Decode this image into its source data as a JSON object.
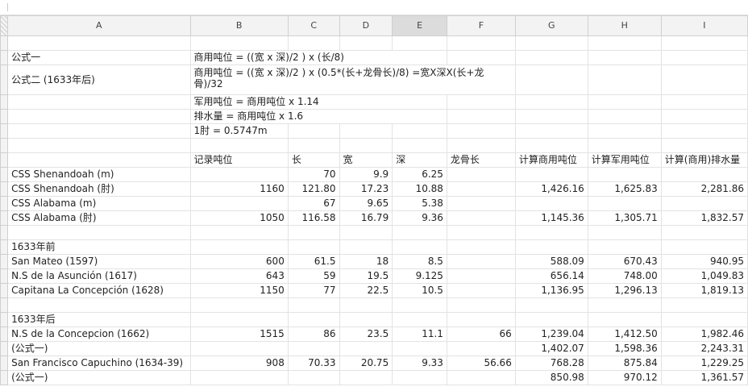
{
  "columns": [
    "A",
    "B",
    "C",
    "D",
    "E",
    "F",
    "G",
    "H",
    "I"
  ],
  "formulas": {
    "f1_label": "公式一",
    "f1_text": "商用吨位 = ((宽 x 深)/2 ) x (长/8)",
    "f2_label": "公式二 (1633年后)",
    "f2_text": "商用吨位 = ((宽 x 深)/2 ) x (0.5*(长+龙骨长)/8) =宽X深X(长+龙骨)/32",
    "military": "军用吨位 = 商用吨位 x 1.14",
    "displacement": "排水量 = 商用吨位 x 1.6",
    "unit": "1肘 = 0.5747m"
  },
  "header": {
    "recorded": "记录吨位",
    "length": "长",
    "width": "宽",
    "depth": "深",
    "keel": "龙骨长",
    "calc_comm": "计算商用吨位",
    "calc_mil": "计算军用吨位",
    "calc_disp": "计算(商用)排水量"
  },
  "rows": {
    "r1": {
      "name": "CSS Shenandoah (m)",
      "c": "70",
      "d": "9.9",
      "e": "6.25"
    },
    "r2": {
      "name": "CSS Shenandoah (肘)",
      "b": "1160",
      "c": "121.80",
      "d": "17.23",
      "e": "10.88",
      "g": "1,426.16",
      "h": "1,625.83",
      "i": "2,281.86"
    },
    "r3": {
      "name": "CSS Alabama (m)",
      "c": "67",
      "d": "9.65",
      "e": "5.38"
    },
    "r4": {
      "name": "CSS Alabama (肘)",
      "b": "1050",
      "c": "116.58",
      "d": "16.79",
      "e": "9.36",
      "g": "1,145.36",
      "h": "1,305.71",
      "i": "1,832.57"
    },
    "sec1": "1633年前",
    "r5": {
      "name": "San Mateo (1597)",
      "b": "600",
      "c": "61.5",
      "d": "18",
      "e": "8.5",
      "g": "588.09",
      "h": "670.43",
      "i": "940.95"
    },
    "r6": {
      "name": "N.S de la Asunción (1617)",
      "b": "643",
      "c": "59",
      "d": "19.5",
      "e": "9.125",
      "g": "656.14",
      "h": "748.00",
      "i": "1,049.83"
    },
    "r7": {
      "name": "Capitana La Concepción (1628)",
      "b": "1150",
      "c": "77",
      "d": "22.5",
      "e": "10.5",
      "g": "1,136.95",
      "h": "1,296.13",
      "i": "1,819.13"
    },
    "sec2": "1633年后",
    "r8": {
      "name": "N.S de la Concepcion (1662)",
      "b": "1515",
      "c": "86",
      "d": "23.5",
      "e": "11.1",
      "f": "66",
      "g": "1,239.04",
      "h": "1,412.50",
      "i": "1,982.46"
    },
    "r9": {
      "name": "(公式一)",
      "g": "1,402.07",
      "h": "1,598.36",
      "i": "2,243.31"
    },
    "r10": {
      "name": "San Francisco Capuchino (1634-39)",
      "b": "908",
      "c": "70.33",
      "d": "20.75",
      "e": "9.33",
      "f": "56.66",
      "g": "768.28",
      "h": "875.84",
      "i": "1,229.25"
    },
    "r11": {
      "name": "(公式一)",
      "g": "850.98",
      "h": "970.12",
      "i": "1,361.57"
    }
  },
  "active_column": "E",
  "colors": {
    "header_bg": "#f3f3f3",
    "active_header_bg": "#dcdcdc",
    "grid": "#e2e3e3"
  }
}
